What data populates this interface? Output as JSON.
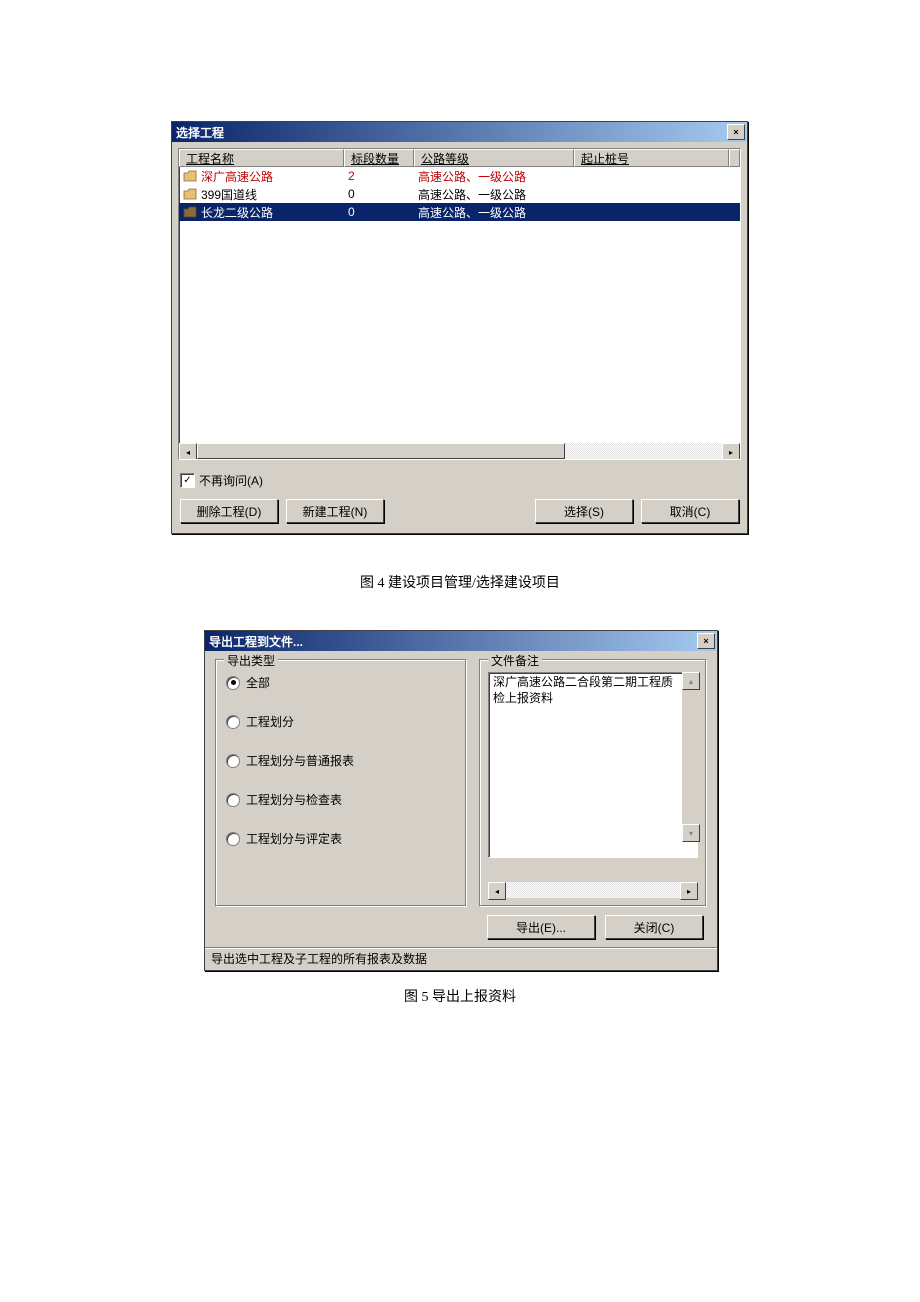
{
  "dialog1": {
    "title": "选择工程",
    "close_mark": "×",
    "columns": {
      "name": "工程名称",
      "qty": "标段数量",
      "grade": "公路等级",
      "stake": "起止桩号"
    },
    "rows": [
      {
        "name": "深广高速公路",
        "qty": "2",
        "grade": "高速公路、一级公路",
        "stake": "",
        "variant": "red",
        "icon": "folder"
      },
      {
        "name": "399国道线",
        "qty": "0",
        "grade": "高速公路、一级公路",
        "stake": "",
        "variant": "normal",
        "icon": "folder"
      },
      {
        "name": "长龙二级公路",
        "qty": "0",
        "grade": "高速公路、一级公路",
        "stake": "",
        "variant": "selected",
        "icon": "folder-dark"
      }
    ],
    "dont_ask_label": "不再询问(A)",
    "dont_ask_checked": true,
    "buttons": {
      "delete": "删除工程(D)",
      "create": "新建工程(N)",
      "select": "选择(S)",
      "cancel": "取消(C)"
    }
  },
  "caption1": "图 4  建设项目管理/选择建设项目",
  "dialog2": {
    "title": "导出工程到文件...",
    "close_mark": "×",
    "group_type": "导出类型",
    "group_note": "文件备注",
    "radios": [
      {
        "label": "全部",
        "checked": true
      },
      {
        "label": "工程划分",
        "checked": false
      },
      {
        "label": "工程划分与普通报表",
        "checked": false
      },
      {
        "label": "工程划分与检查表",
        "checked": false
      },
      {
        "label": "工程划分与评定表",
        "checked": false
      }
    ],
    "note_text": "深广高速公路二合段第二期工程质检上报资料",
    "buttons": {
      "export": "导出(E)...",
      "close": "关闭(C)"
    },
    "status": "导出选中工程及子工程的所有报表及数据"
  },
  "caption2": "图 5  导出上报资料"
}
